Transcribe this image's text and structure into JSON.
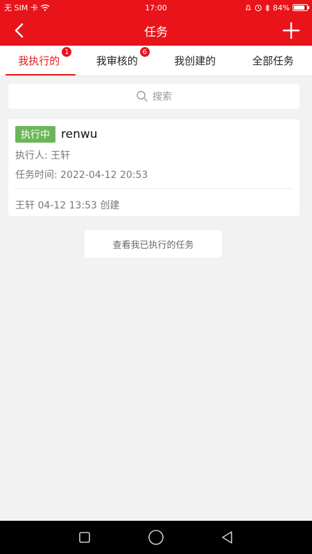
{
  "status_bar": {
    "carrier": "无 SIM 卡",
    "time": "17:00",
    "battery": "84%",
    "battery_level": 0.84
  },
  "header": {
    "title": "任务"
  },
  "tabs": [
    {
      "label": "我执行的",
      "badge": "1",
      "active": true
    },
    {
      "label": "我审核的",
      "badge": "6",
      "active": false
    },
    {
      "label": "我创建的",
      "badge": "",
      "active": false
    },
    {
      "label": "全部任务",
      "badge": "",
      "active": false
    }
  ],
  "search": {
    "placeholder": "搜索"
  },
  "task": {
    "status": "执行中",
    "title": "renwu",
    "executor": "执行人: 王轩",
    "time": "任务时间: 2022-04-12 20:53",
    "created": "王轩 04-12 13:53 创建"
  },
  "view_more": {
    "label": "查看我已执行的任务"
  },
  "colors": {
    "primary": "#e8141a",
    "status_green": "#6cb65a"
  }
}
